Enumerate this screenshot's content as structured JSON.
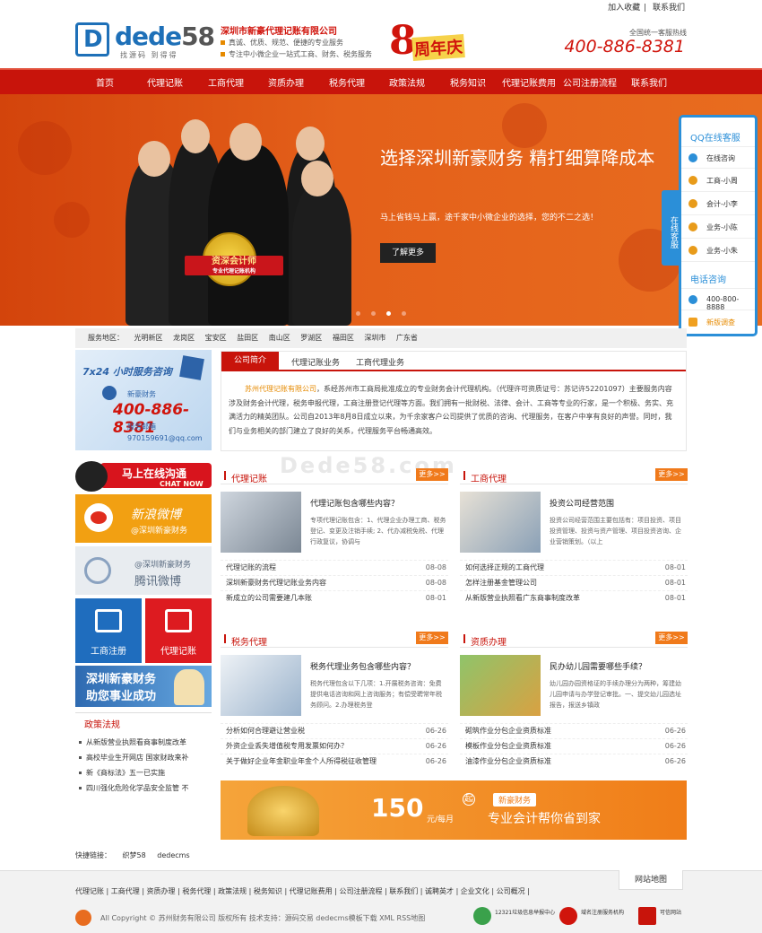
{
  "topbar": {
    "fav": "加入收藏",
    "contact": "联系我们"
  },
  "header": {
    "logo_word": "dede",
    "logo_num": "58",
    "logo_sub": "找源码 到得得",
    "company": "深圳市新豪代理记账有限公司",
    "slogan1": "真诚、优质、规范、便捷的专业服务",
    "slogan2": "专注中小微企业一站式工商、财务、税务服务",
    "anniv_num": "8",
    "anniv_label": "周年庆",
    "hotline_label": "全国统一客服热线",
    "hotline": "400-886-8381"
  },
  "nav": [
    "首页",
    "代理记账",
    "工商代理",
    "资质办理",
    "税务代理",
    "政策法规",
    "税务知识",
    "代理记账费用",
    "公司注册流程",
    "联系我们"
  ],
  "banner": {
    "title": "选择深圳新豪财务 精打细算降成本",
    "subtitle": "马上省钱马上赢，途千家中小微企业的选择，您的不二之选！",
    "button": "了解更多",
    "seal_main": "资深会计师",
    "seal_sub": "专业代理记账机构",
    "active_slide": 3,
    "slide_count": 4
  },
  "qq_panel": {
    "title": "QQ在线客服",
    "items": [
      "在线咨询",
      "工商-小周",
      "会计-小李",
      "业务-小陈",
      "业务-小朱"
    ],
    "phone_title": "电话咨询",
    "phone": "400-800-8888",
    "survey": "新版调查",
    "tab": "在线客服"
  },
  "areas": {
    "label": "服务地区：",
    "items": [
      "光明新区",
      "龙岗区",
      "宝安区",
      "盐田区",
      "南山区",
      "罗湖区",
      "福田区",
      "深圳市",
      "广东省"
    ]
  },
  "sidebar": {
    "service_title": "7x24 小时服务咨询",
    "service_phone_label": "新豪财务",
    "service_phone": "400-886-8381",
    "service_mail_label": "服务邮箱",
    "service_mail": "970159691@qq.com",
    "chat_text": "马上在线沟通",
    "chat_en": "CHAT NOW",
    "weibo_title": "新浪微博",
    "weibo_sub": "@深圳新豪财务",
    "tencent_sub": "@深圳新豪财务",
    "tencent_title": "腾讯微博",
    "tile_a": "工商注册",
    "tile_b": "代理记账",
    "assist1": "深圳新豪财务",
    "assist2": "助您事业成功",
    "policy_title": "政策法规",
    "policy_items": [
      "从新版营业执照看商事制度改革",
      "高校毕业生开网店 国家财政来补",
      "新《商标法》五一已实施",
      "四川强化危险化学品安全监管 不"
    ]
  },
  "intro": {
    "tabs": [
      "公司简介",
      "代理记账业务",
      "工商代理业务"
    ],
    "highlight": "苏州代理记账有限公司",
    "body": "，系经苏州市工商局批准成立的专业财务会计代理机构。（代理许可资质证号：苏记许52201097）主要服务内容涉及财务会计代理，税务申报代理，工商注册登记代理等方面。我们拥有一批财税、法律、会计、工商等专业的行家，是一个积极、务实、充满活力的精英团队。公司自2013年8月8日成立以来，为千余家客户公司提供了优质的咨询、代理服务，在客户中享有良好的声誉。同时，我们与业务相关的部门建立了良好的关系，代理服务平台畅通高效。"
  },
  "watermark": "Dede58.com",
  "panels": [
    {
      "title": "代理记账",
      "more": "更多>>",
      "feat_title": "代理记账包含哪些内容？",
      "feat_desc": "专项代理记账包含：1、代理企业办理工商、税务登记、变更及注销手续; 2、代办减税免税、代理行政复议，协调与",
      "items": [
        [
          "代理记账的流程",
          "08-08"
        ],
        [
          "深圳新豪财务代理记账业务内容",
          "08-08"
        ],
        [
          "新成立的公司需要建几本账",
          "08-01"
        ]
      ]
    },
    {
      "title": "工商代理",
      "more": "更多>>",
      "feat_title": "投资公司经营范围",
      "feat_desc": "投资公司经营范围主要包括有：项目投资、项目投资管理、投资与资产管理、项目投资咨询、企业营销策划。（以上",
      "items": [
        [
          "如何选择正规的工商代理",
          "08-01"
        ],
        [
          "怎样注册基金管理公司",
          "08-01"
        ],
        [
          "从新版营业执照看广东商事制度改革",
          "08-01"
        ]
      ]
    },
    {
      "title": "税务代理",
      "more": "更多>>",
      "feat_title": "税务代理业务包含哪些内容？",
      "feat_desc": "税务代理包含以下几项：1.开展税务咨询：免费提供电话咨询和网上咨询服务；有偿受聘常年税务顾问。2.办理税务登",
      "items": [
        [
          "分析如何合理避让营业税",
          "06-26"
        ],
        [
          "外资企业丢失增值税专用发票如何办？",
          "06-26"
        ],
        [
          "关于做好企业年金职业年金个人所得税征收管理",
          "06-26"
        ]
      ]
    },
    {
      "title": "资质办理",
      "more": "更多>>",
      "feat_title": "民办幼儿园需要哪些手续？",
      "feat_desc": "幼儿园办园资格证的手续办理分为两种，筹建幼儿园申请与办学登记审批。一、提交幼儿园选址报告，报送乡镇政",
      "items": [
        [
          "砌筑作业分包企业资质标准",
          "06-26"
        ],
        [
          "模板作业分包企业资质标准",
          "06-26"
        ],
        [
          "油漆作业分包企业资质标准",
          "06-26"
        ]
      ]
    }
  ],
  "promo": {
    "qi": "起",
    "price": "150",
    "per": "元/每月",
    "tag": "新豪财务",
    "text": "专业会计帮你省到家"
  },
  "quick_links": {
    "label": "快捷链接：",
    "items": [
      "织梦58",
      "dedecms"
    ]
  },
  "footer": {
    "sitemap": "网站地图",
    "links": "代理记账 | 工商代理 | 资质办理 | 税务代理 | 政策法规 | 税务知识 | 代理记账费用 | 公司注册流程 | 联系我们 | 诚聘英才 | 企业文化 | 公司概况 |",
    "copyright": "All Copyright © 苏州财务有限公司 版权所有 技术支持：源码交易 dedecms模板下载 XML RSS地图",
    "cert1": "12321垃圾信息举报中心",
    "cert2": "域名注册服务机构",
    "cert3": "可信网站"
  },
  "colors": {
    "brand_red": "#c8140b",
    "accent_orange": "#f07a1b",
    "qq_blue": "#2b8fd8"
  }
}
